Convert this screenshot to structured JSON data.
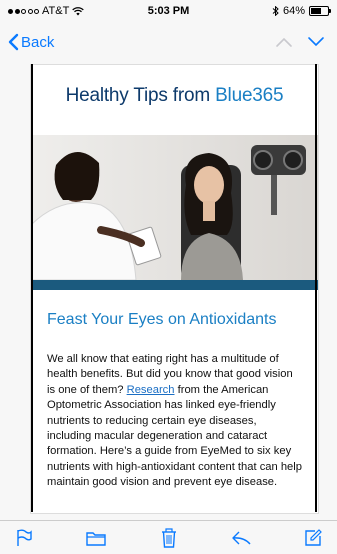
{
  "status": {
    "carrier": "AT&T",
    "time": "5:03 PM",
    "battery": "64%",
    "battery_level": 0.64
  },
  "nav": {
    "back_label": "Back"
  },
  "email": {
    "brand_prefix": "Healthy Tips from ",
    "brand_name": "Blue365",
    "headline": "Feast Your Eyes on Antioxidants",
    "body_before_link": "We all know that eating right has a multitude of health benefits. But did you know that good vision is one of them? ",
    "link_text": "Research",
    "body_after_link": " from the American Optometric Association has linked eye-friendly nutrients to reducing certain eye diseases, including macular degeneration and cataract formation. Here’s a guide from EyeMed to six key nutrients with high-antioxidant content that can help maintain good vision and prevent eye disease."
  },
  "toolbar": {
    "icons": [
      "flag-icon",
      "folder-icon",
      "trash-icon",
      "reply-icon",
      "compose-icon"
    ]
  },
  "colors": {
    "ios_blue": "#0a7aff",
    "brand_navy": "#0d3a6b",
    "brand_blue": "#1a7fc4",
    "hero_bar": "#1b5a7e"
  }
}
